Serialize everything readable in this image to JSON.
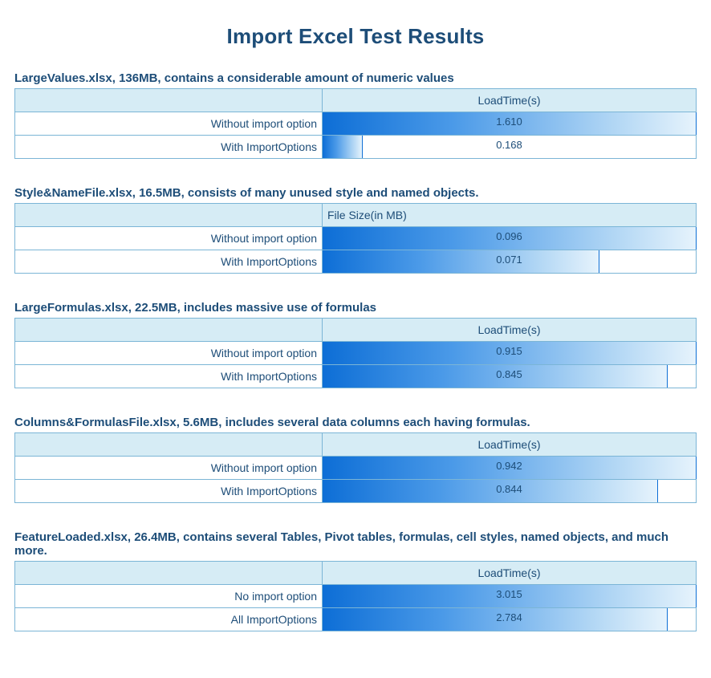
{
  "title": "Import Excel Test Results",
  "sections": [
    {
      "section_title": "LargeValues.xlsx,  136MB, contains a considerable amount of numeric values",
      "metric_label": "LoadTime(s)",
      "metric_align": "center",
      "rows": [
        {
          "label": "Without import option",
          "value_text": "1.610",
          "value": 1.61,
          "max": 1.61
        },
        {
          "label": "With ImportOptions",
          "value_text": "0.168",
          "value": 0.168,
          "max": 1.61
        }
      ]
    },
    {
      "section_title": "Style&NameFile.xlsx, 16.5MB, consists of many unused style and named objects.",
      "metric_label": "File Size(in MB)",
      "metric_align": "left",
      "rows": [
        {
          "label": "Without import option",
          "value_text": "0.096",
          "value": 0.096,
          "max": 0.096
        },
        {
          "label": "With ImportOptions",
          "value_text": "0.071",
          "value": 0.071,
          "max": 0.096
        }
      ]
    },
    {
      "section_title": "LargeFormulas.xlsx,  22.5MB, includes massive use of formulas",
      "metric_label": "LoadTime(s)",
      "metric_align": "center",
      "rows": [
        {
          "label": "Without import option",
          "value_text": "0.915",
          "value": 0.915,
          "max": 0.915
        },
        {
          "label": "With ImportOptions",
          "value_text": "0.845",
          "value": 0.845,
          "max": 0.915
        }
      ]
    },
    {
      "section_title": "Columns&FormulasFile.xlsx, 5.6MB, includes several data columns each having formulas.",
      "metric_label": "LoadTime(s)",
      "metric_align": "center",
      "rows": [
        {
          "label": "Without import option",
          "value_text": "0.942",
          "value": 0.942,
          "max": 0.942
        },
        {
          "label": "With ImportOptions",
          "value_text": "0.844",
          "value": 0.844,
          "max": 0.942
        }
      ]
    },
    {
      "section_title": "FeatureLoaded.xlsx, 26.4MB, contains several Tables, Pivot tables, formulas, cell styles, named objects, and much more.",
      "metric_label": "LoadTime(s)",
      "metric_align": "center",
      "rows": [
        {
          "label": "No import option",
          "value_text": "3.015",
          "value": 3.015,
          "max": 3.015
        },
        {
          "label": "All ImportOptions",
          "value_text": "2.784",
          "value": 2.784,
          "max": 3.015
        }
      ]
    }
  ],
  "chart_data": [
    {
      "type": "bar",
      "title": "LargeValues.xlsx,  136MB, contains a considerable amount of numeric values",
      "xlabel": "",
      "ylabel": "LoadTime(s)",
      "ylim": [
        0,
        1.61
      ],
      "categories": [
        "Without import option",
        "With ImportOptions"
      ],
      "values": [
        1.61,
        0.168
      ]
    },
    {
      "type": "bar",
      "title": "Style&NameFile.xlsx, 16.5MB, consists of many unused style and named objects.",
      "xlabel": "",
      "ylabel": "File Size(in MB)",
      "ylim": [
        0,
        0.096
      ],
      "categories": [
        "Without import option",
        "With ImportOptions"
      ],
      "values": [
        0.096,
        0.071
      ]
    },
    {
      "type": "bar",
      "title": "LargeFormulas.xlsx,  22.5MB, includes massive use of formulas",
      "xlabel": "",
      "ylabel": "LoadTime(s)",
      "ylim": [
        0,
        0.915
      ],
      "categories": [
        "Without import option",
        "With ImportOptions"
      ],
      "values": [
        0.915,
        0.845
      ]
    },
    {
      "type": "bar",
      "title": "Columns&FormulasFile.xlsx, 5.6MB, includes several data columns each having formulas.",
      "xlabel": "",
      "ylabel": "LoadTime(s)",
      "ylim": [
        0,
        0.942
      ],
      "categories": [
        "Without import option",
        "With ImportOptions"
      ],
      "values": [
        0.942,
        0.844
      ]
    },
    {
      "type": "bar",
      "title": "FeatureLoaded.xlsx, 26.4MB, contains several Tables, Pivot tables, formulas, cell styles, named objects, and much more.",
      "xlabel": "",
      "ylabel": "LoadTime(s)",
      "ylim": [
        0,
        3.015
      ],
      "categories": [
        "No import option",
        "All ImportOptions"
      ],
      "values": [
        3.015,
        2.784
      ]
    }
  ]
}
